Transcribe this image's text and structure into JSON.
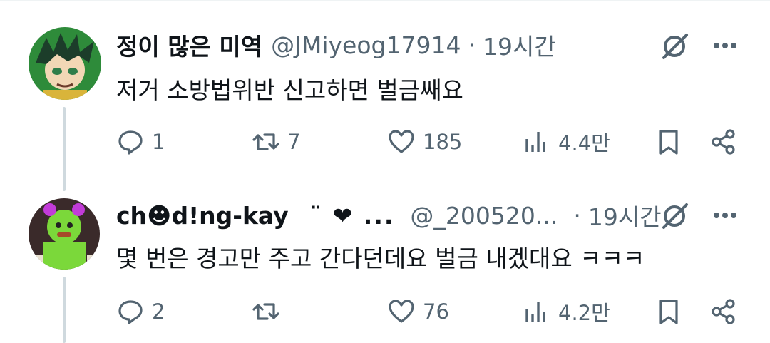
{
  "tweets": [
    {
      "name": "정이 많은 미역",
      "handle": "@JMiyeog17914",
      "separator": "·",
      "time": "19시간",
      "text": "저거 소방법위반 신고하면 벌금쌔요",
      "badges": "",
      "stats": {
        "replies": "1",
        "retweets": "7",
        "likes": "185",
        "views": "4.4만"
      },
      "avatar_colors": {
        "bg": "#2e8b3a",
        "hair": "#1c3d2a",
        "face": "#f2d7b5"
      }
    },
    {
      "name": "ch☻d!ng-kay",
      "handle": "@_200520...",
      "separator": "·",
      "time": "19시간",
      "text": "몇 번은 경고만 주고 간다던데요 벌금 내겠대요 ㅋㅋㅋ",
      "badges": "¨ ❤ ...",
      "stats": {
        "replies": "2",
        "retweets": "",
        "likes": "76",
        "views": "4.2만"
      },
      "avatar_colors": {
        "bg": "#3a2a2a",
        "body": "#7bd83a",
        "accent": "#c23bd8"
      }
    }
  ],
  "icons": {
    "grok": "grok-icon",
    "more": "more-icon",
    "reply": "reply-icon",
    "retweet": "retweet-icon",
    "like": "like-icon",
    "views": "views-icon",
    "bookmark": "bookmark-icon",
    "share": "share-icon"
  },
  "colors": {
    "text": "#0f1419",
    "secondary": "#536471",
    "thread": "#cfd9de"
  }
}
